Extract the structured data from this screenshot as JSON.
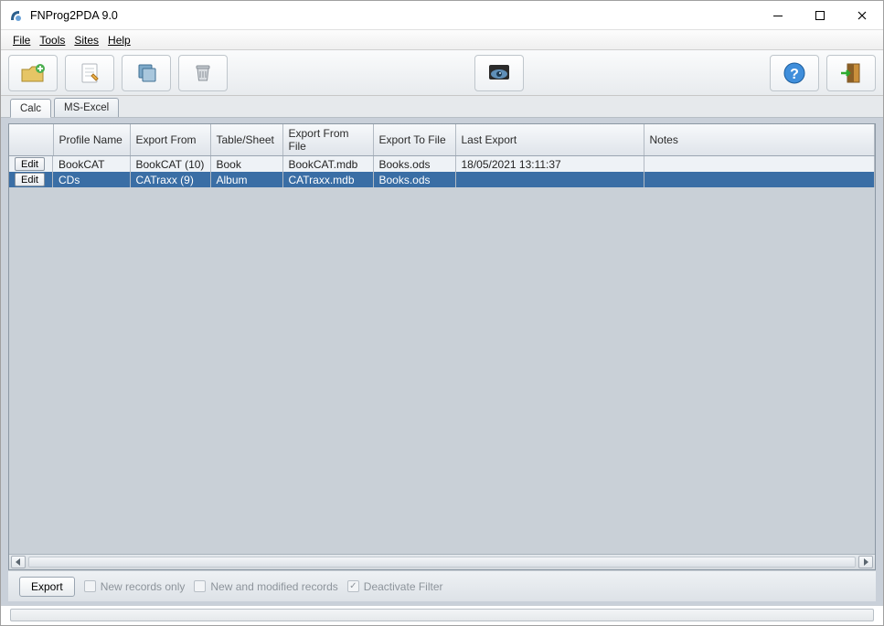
{
  "title": "FNProg2PDA 9.0",
  "menu": {
    "file": "File",
    "tools": "Tools",
    "sites": "Sites",
    "help": "Help"
  },
  "tabs": {
    "calc": "Calc",
    "msexcel": "MS-Excel"
  },
  "columns": {
    "profile_name": "Profile Name",
    "export_from": "Export From",
    "table_sheet": "Table/Sheet",
    "export_from_file": "Export From File",
    "export_to_file": "Export To File",
    "last_export": "Last Export",
    "notes": "Notes"
  },
  "edit_label": "Edit",
  "rows": [
    {
      "profile_name": "BookCAT",
      "export_from": "BookCAT (10)",
      "table_sheet": "Book",
      "export_from_file": "BookCAT.mdb",
      "export_to_file": "Books.ods",
      "last_export": "18/05/2021 13:11:37",
      "notes": ""
    },
    {
      "profile_name": "CDs",
      "export_from": "CATraxx (9)",
      "table_sheet": "Album",
      "export_from_file": "CATraxx.mdb",
      "export_to_file": "Books.ods",
      "last_export": "",
      "notes": ""
    }
  ],
  "bottom": {
    "export": "Export",
    "new_records": "New records only",
    "new_modified": "New and modified records",
    "deactivate_filter": "Deactivate Filter"
  }
}
